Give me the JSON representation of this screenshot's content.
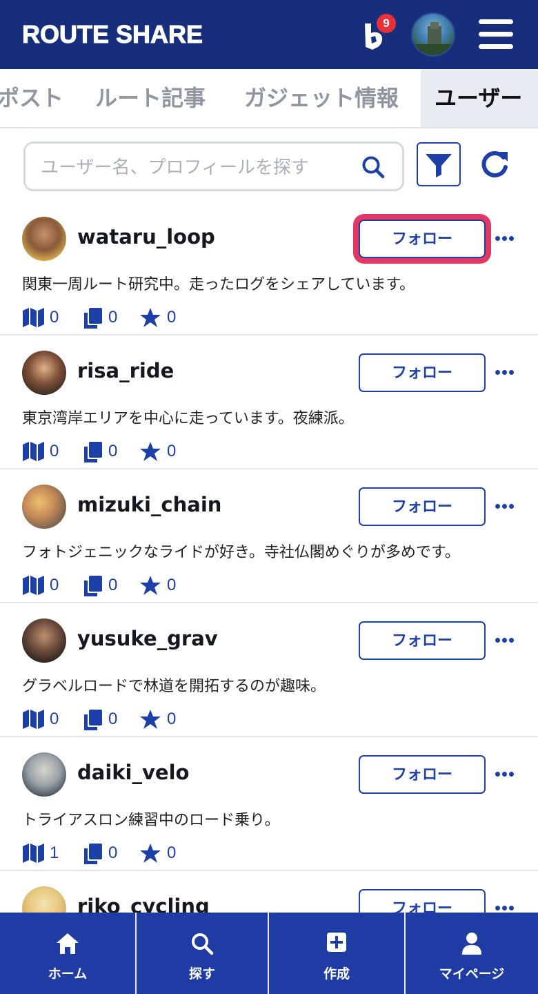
{
  "app": {
    "title": "ROUTE SHARE",
    "notification_count": "9"
  },
  "tabs": [
    {
      "label": "ポスト"
    },
    {
      "label": "ルート記事"
    },
    {
      "label": "ガジェット情報"
    },
    {
      "label": "ユーザー",
      "active": true
    }
  ],
  "search": {
    "placeholder": "ユーザー名、プロフィールを探す",
    "value": ""
  },
  "users": [
    {
      "name": "wataru_loop",
      "bio": "関東一周ルート研究中。走ったログをシェアしています。",
      "routes": "0",
      "copies": "0",
      "favorites": "0",
      "follow_label": "フォロー"
    },
    {
      "name": "risa_ride",
      "bio": "東京湾岸エリアを中心に走っています。夜練派。",
      "routes": "0",
      "copies": "0",
      "favorites": "0",
      "follow_label": "フォロー"
    },
    {
      "name": "mizuki_chain",
      "bio": "フォトジェニックなライドが好き。寺社仏閣めぐりが多めです。",
      "routes": "0",
      "copies": "0",
      "favorites": "0",
      "follow_label": "フォロー"
    },
    {
      "name": "yusuke_grav",
      "bio": "グラベルロードで林道を開拓するのが趣味。",
      "routes": "0",
      "copies": "0",
      "favorites": "0",
      "follow_label": "フォロー"
    },
    {
      "name": "daiki_velo",
      "bio": "トライアスロン練習中のロード乗り。",
      "routes": "1",
      "copies": "0",
      "favorites": "0",
      "follow_label": "フォロー"
    },
    {
      "name": "riko_cycling",
      "follow_label": "フォロー"
    }
  ],
  "bottom_nav": [
    {
      "label": "ホーム",
      "icon": "home-icon"
    },
    {
      "label": "探す",
      "icon": "search-icon"
    },
    {
      "label": "作成",
      "icon": "plus-square-icon"
    },
    {
      "label": "マイページ",
      "icon": "user-icon"
    }
  ],
  "colors": {
    "header": "#172e7c",
    "accent": "#1d3fa8",
    "badge": "#e8303a",
    "focus_ring": "#e43764",
    "nav": "#1e3ca3"
  }
}
